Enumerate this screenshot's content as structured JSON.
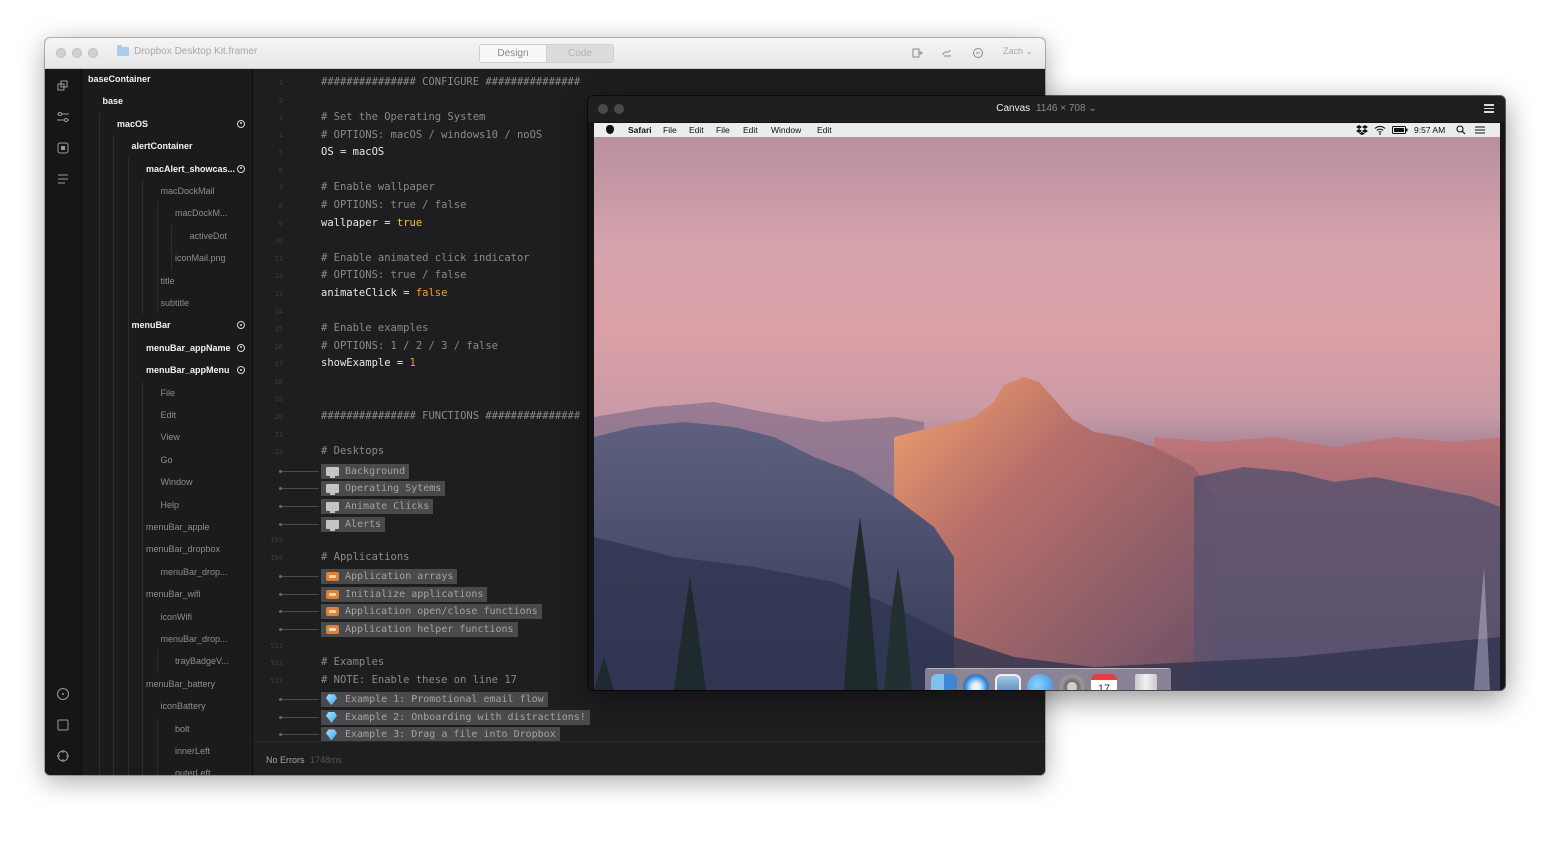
{
  "framer_window": {
    "title": "Dropbox Desktop Kit.framer",
    "tabs": {
      "design": "Design",
      "code": "Code",
      "active": "Code"
    },
    "user": "Zach",
    "user_caret": "⌄"
  },
  "layers": [
    {
      "name": "baseContainer",
      "level": 0,
      "bright": true,
      "eye": false
    },
    {
      "name": "base",
      "level": 1,
      "bright": true,
      "eye": false
    },
    {
      "name": "macOS",
      "level": 2,
      "bright": true,
      "eye": true
    },
    {
      "name": "alertContainer",
      "level": 3,
      "bright": true,
      "eye": false
    },
    {
      "name": "macAlert_showcas...",
      "level": 4,
      "bright": true,
      "eye": true
    },
    {
      "name": "macDockMail",
      "level": 5,
      "bright": false,
      "eye": false
    },
    {
      "name": "macDockM...",
      "level": 6,
      "bright": false,
      "eye": false
    },
    {
      "name": "activeDot",
      "level": 7,
      "bright": false,
      "eye": false
    },
    {
      "name": "iconMail.png",
      "level": 6,
      "bright": false,
      "eye": false
    },
    {
      "name": "title",
      "level": 5,
      "bright": false,
      "eye": false
    },
    {
      "name": "subtitle",
      "level": 5,
      "bright": false,
      "eye": false
    },
    {
      "name": "menuBar",
      "level": 3,
      "bright": true,
      "eye": true
    },
    {
      "name": "menuBar_appName",
      "level": 4,
      "bright": true,
      "eye": true
    },
    {
      "name": "menuBar_appMenu",
      "level": 4,
      "bright": true,
      "eye": true
    },
    {
      "name": "File",
      "level": 5,
      "bright": false,
      "eye": false
    },
    {
      "name": "Edit",
      "level": 5,
      "bright": false,
      "eye": false
    },
    {
      "name": "View",
      "level": 5,
      "bright": false,
      "eye": false
    },
    {
      "name": "Go",
      "level": 5,
      "bright": false,
      "eye": false
    },
    {
      "name": "Window",
      "level": 5,
      "bright": false,
      "eye": false
    },
    {
      "name": "Help",
      "level": 5,
      "bright": false,
      "eye": false
    },
    {
      "name": "menuBar_apple",
      "level": 4,
      "bright": false,
      "eye": false
    },
    {
      "name": "menuBar_dropbox",
      "level": 4,
      "bright": false,
      "eye": false
    },
    {
      "name": "menuBar_drop...",
      "level": 5,
      "bright": false,
      "eye": false
    },
    {
      "name": "menuBar_wifi",
      "level": 4,
      "bright": false,
      "eye": false
    },
    {
      "name": "iconWifi",
      "level": 5,
      "bright": false,
      "eye": false
    },
    {
      "name": "menuBar_drop...",
      "level": 5,
      "bright": false,
      "eye": false
    },
    {
      "name": "trayBadgeV...",
      "level": 6,
      "bright": false,
      "eye": false
    },
    {
      "name": "menuBar_battery",
      "level": 4,
      "bright": false,
      "eye": false
    },
    {
      "name": "iconBattery",
      "level": 5,
      "bright": false,
      "eye": false
    },
    {
      "name": "bolt",
      "level": 6,
      "bright": false,
      "eye": false
    },
    {
      "name": "innerLeft",
      "level": 6,
      "bright": false,
      "eye": false
    },
    {
      "name": "outerLeft",
      "level": 6,
      "bright": false,
      "eye": false
    }
  ],
  "code_lines": [
    {
      "n": "1",
      "kind": "comment",
      "text": "############### CONFIGURE ###############"
    },
    {
      "n": "2",
      "kind": "blank",
      "text": ""
    },
    {
      "n": "3",
      "kind": "comment",
      "text": "# Set the Operating System"
    },
    {
      "n": "4",
      "kind": "comment",
      "text": "# OPTIONS: macOS / windows10 / noOS"
    },
    {
      "n": "5",
      "kind": "assign",
      "text": "OS = macOS",
      "var": "OS",
      "value": "macOS",
      "vtype": "plain"
    },
    {
      "n": "6",
      "kind": "blank",
      "text": ""
    },
    {
      "n": "7",
      "kind": "comment",
      "text": "# Enable wallpaper"
    },
    {
      "n": "8",
      "kind": "comment",
      "text": "# OPTIONS: true / false"
    },
    {
      "n": "9",
      "kind": "assign",
      "text": "wallpaper = true",
      "var": "wallpaper",
      "value": "true",
      "vtype": "true"
    },
    {
      "n": "10",
      "kind": "blank",
      "text": ""
    },
    {
      "n": "11",
      "kind": "comment",
      "text": "# Enable animated click indicator"
    },
    {
      "n": "12",
      "kind": "comment",
      "text": "# OPTIONS: true / false"
    },
    {
      "n": "13",
      "kind": "assign",
      "text": "animateClick = false",
      "var": "animateClick",
      "value": "false",
      "vtype": "false"
    },
    {
      "n": "14",
      "kind": "blank",
      "text": ""
    },
    {
      "n": "15",
      "kind": "comment",
      "text": "# Enable examples"
    },
    {
      "n": "16",
      "kind": "comment",
      "text": "# OPTIONS: 1 / 2 / 3 / false"
    },
    {
      "n": "17",
      "kind": "assign",
      "text": "showExample = 1",
      "var": "showExample",
      "value": "1",
      "vtype": "num"
    },
    {
      "n": "18",
      "kind": "blank",
      "text": ""
    },
    {
      "n": "19",
      "kind": "blank",
      "text": ""
    },
    {
      "n": "20",
      "kind": "comment",
      "text": "############### FUNCTIONS ###############"
    },
    {
      "n": "21",
      "kind": "blank",
      "text": ""
    },
    {
      "n": "22",
      "kind": "comment",
      "text": "# Desktops"
    },
    {
      "n": "",
      "kind": "fold",
      "icon": "desktop",
      "text": "Background"
    },
    {
      "n": "",
      "kind": "fold",
      "icon": "desktop",
      "text": "Operating Sytems"
    },
    {
      "n": "",
      "kind": "fold",
      "icon": "desktop",
      "text": "Animate Clicks"
    },
    {
      "n": "",
      "kind": "fold",
      "icon": "desktop",
      "text": "Alerts"
    },
    {
      "n": "193",
      "kind": "blank",
      "text": ""
    },
    {
      "n": "194",
      "kind": "comment",
      "text": "# Applications"
    },
    {
      "n": "",
      "kind": "fold",
      "icon": "app",
      "text": "Application arrays"
    },
    {
      "n": "",
      "kind": "fold",
      "icon": "app",
      "text": "Initialize applications"
    },
    {
      "n": "",
      "kind": "fold",
      "icon": "app",
      "text": "Application open/close functions"
    },
    {
      "n": "",
      "kind": "fold",
      "icon": "app",
      "text": "Application helper functions"
    },
    {
      "n": "511",
      "kind": "blank",
      "text": ""
    },
    {
      "n": "512",
      "kind": "comment",
      "text": "# Examples"
    },
    {
      "n": "513",
      "kind": "comment",
      "text": "# NOTE: Enable these on line 17"
    },
    {
      "n": "",
      "kind": "fold",
      "icon": "gem",
      "text": "Example 1: Promotional email flow"
    },
    {
      "n": "",
      "kind": "fold",
      "icon": "gem",
      "text": "Example 2: Onboarding with distractions!"
    },
    {
      "n": "",
      "kind": "fold",
      "icon": "gem",
      "text": "Example 3: Drag a file into Dropbox"
    }
  ],
  "status": {
    "text": "No Errors",
    "time": "1748ms"
  },
  "canvas_window": {
    "title": "Canvas",
    "size": "1146 × 708",
    "caret": "⌄",
    "mac_menubar": {
      "app": "Safari",
      "menus": [
        "File",
        "Edit",
        "File",
        "Edit",
        "Window",
        "Edit"
      ],
      "clock": "9:57 AM"
    },
    "dock_apps": [
      "finder-icon",
      "safari-icon",
      "preview-icon",
      "messages-icon",
      "system-preferences-icon",
      "calendar-icon",
      "trash-icon"
    ],
    "calendar_day": "17"
  }
}
